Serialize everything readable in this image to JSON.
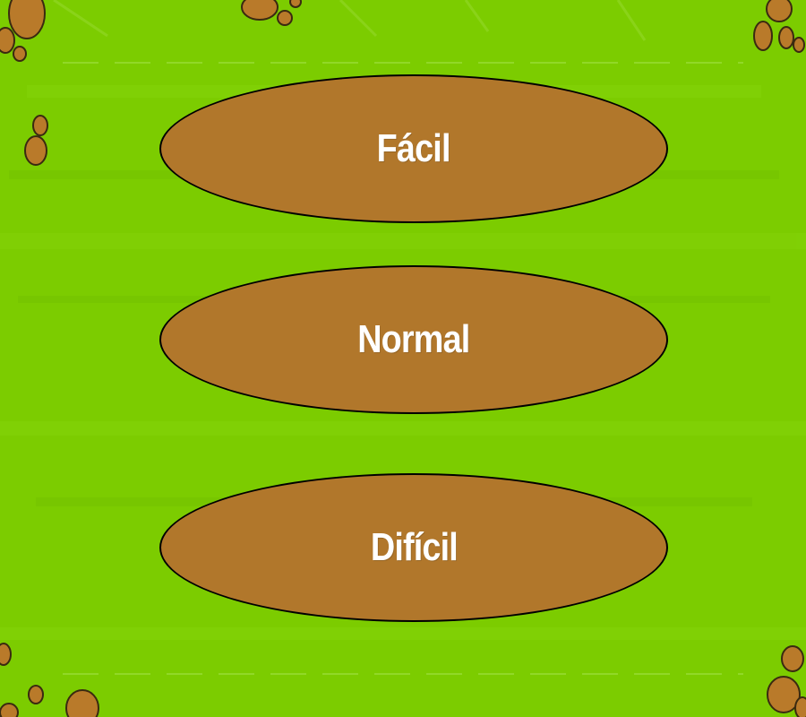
{
  "colors": {
    "grass": "#7ccc00",
    "grass_dark": "#6fbb00",
    "grass_light": "#8ad60e",
    "button_fill": "#b1772b",
    "button_border": "#000000",
    "label": "#ffffff",
    "pebble": "#b97a2a"
  },
  "menu": {
    "options": [
      {
        "label": "Fácil"
      },
      {
        "label": "Normal"
      },
      {
        "label": "Difícil"
      }
    ]
  },
  "decorations": {
    "pebble_icon": "pebble-cluster-icon"
  }
}
